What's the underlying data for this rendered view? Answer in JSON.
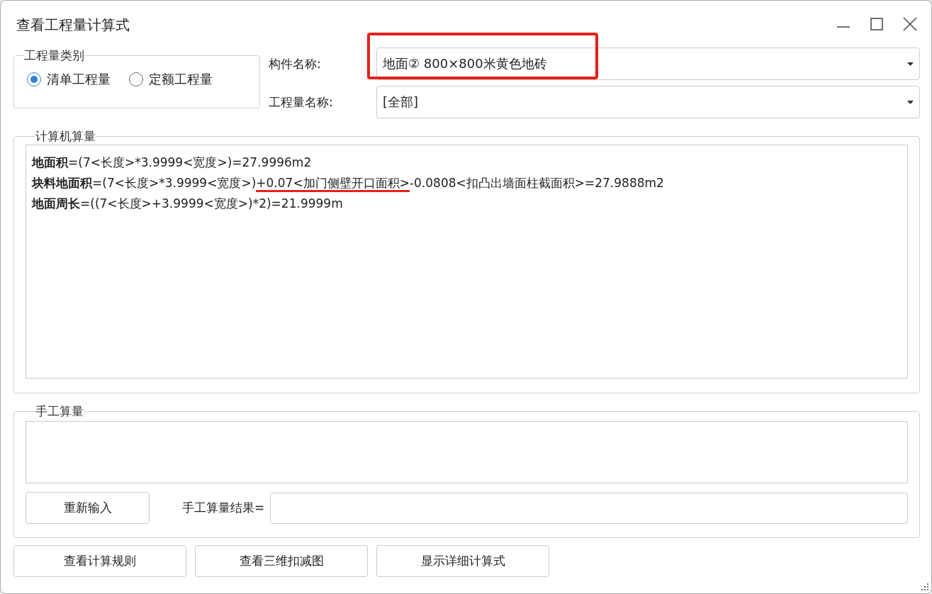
{
  "window": {
    "title": "查看工程量计算式"
  },
  "quantity_type": {
    "legend": "工程量类别",
    "options": [
      {
        "label": "清单工程量",
        "selected": true
      },
      {
        "label": "定额工程量",
        "selected": false
      }
    ]
  },
  "fields": [
    {
      "label": "构件名称:",
      "value": "地面② 800×800米黄色地砖",
      "highlighted": true
    },
    {
      "label": "工程量名称:",
      "value": "[全部]",
      "highlighted": false
    }
  ],
  "computer": {
    "legend": "计算机算量",
    "lines": [
      {
        "parts": [
          {
            "kind": "label",
            "text": "地面积"
          },
          {
            "kind": "plain",
            "text": "=(7<长度>*3.9999<宽度>)=27.9996m2"
          }
        ]
      },
      {
        "parts": [
          {
            "kind": "label",
            "text": "块料地面积"
          },
          {
            "kind": "plain",
            "text": "=(7<长度>*3.9999<宽度>)"
          },
          {
            "kind": "marked",
            "text": "+0.07<加门侧壁开口面积>"
          },
          {
            "kind": "plain",
            "text": "-0.0808<扣凸出墙面柱截面积>=27.9888m2"
          }
        ]
      },
      {
        "parts": [
          {
            "kind": "label",
            "text": "地面周长"
          },
          {
            "kind": "plain",
            "text": "=((7<长度>+3.9999<宽度>)*2)=21.9999m"
          }
        ]
      }
    ]
  },
  "manual": {
    "legend": "手工算量",
    "reenter_button": "重新输入",
    "result_label": "手工算量结果="
  },
  "buttons": [
    "查看计算规则",
    "查看三维扣减图",
    "显示详细计算式"
  ]
}
